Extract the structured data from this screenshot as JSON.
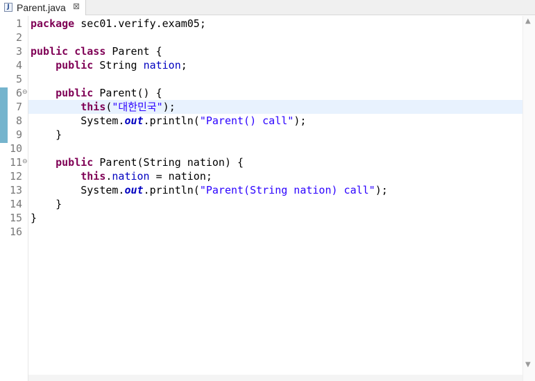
{
  "tab": {
    "title": "Parent.java",
    "icon": "java-file-icon",
    "close_glyph": "⊠"
  },
  "editor": {
    "lines": [
      {
        "n": "1",
        "tokens": [
          {
            "t": "package",
            "c": "kw"
          },
          {
            "t": " sec01.verify.exam05;",
            "c": ""
          }
        ]
      },
      {
        "n": "2",
        "tokens": []
      },
      {
        "n": "3",
        "tokens": [
          {
            "t": "public",
            "c": "kw"
          },
          {
            "t": " ",
            "c": ""
          },
          {
            "t": "class",
            "c": "kw"
          },
          {
            "t": " Parent {",
            "c": ""
          }
        ]
      },
      {
        "n": "4",
        "tokens": [
          {
            "t": "    ",
            "c": ""
          },
          {
            "t": "public",
            "c": "kw"
          },
          {
            "t": " String ",
            "c": ""
          },
          {
            "t": "nation",
            "c": "fld"
          },
          {
            "t": ";",
            "c": ""
          }
        ]
      },
      {
        "n": "5",
        "tokens": []
      },
      {
        "n": "6",
        "fold": true,
        "tokens": [
          {
            "t": "    ",
            "c": ""
          },
          {
            "t": "public",
            "c": "kw"
          },
          {
            "t": " Parent() {",
            "c": ""
          }
        ]
      },
      {
        "n": "7",
        "highlight": true,
        "tokens": [
          {
            "t": "        ",
            "c": ""
          },
          {
            "t": "this",
            "c": "kw"
          },
          {
            "t": "(",
            "c": ""
          },
          {
            "t": "\"대한민국\"",
            "c": "str"
          },
          {
            "t": ");",
            "c": ""
          }
        ]
      },
      {
        "n": "8",
        "tokens": [
          {
            "t": "        System.",
            "c": ""
          },
          {
            "t": "out",
            "c": "sfld"
          },
          {
            "t": ".println(",
            "c": ""
          },
          {
            "t": "\"Parent() call\"",
            "c": "str"
          },
          {
            "t": ");",
            "c": ""
          }
        ]
      },
      {
        "n": "9",
        "tokens": [
          {
            "t": "    }",
            "c": ""
          }
        ]
      },
      {
        "n": "10",
        "tokens": []
      },
      {
        "n": "11",
        "fold": true,
        "tokens": [
          {
            "t": "    ",
            "c": ""
          },
          {
            "t": "public",
            "c": "kw"
          },
          {
            "t": " Parent(String nation) {",
            "c": ""
          }
        ]
      },
      {
        "n": "12",
        "tokens": [
          {
            "t": "        ",
            "c": ""
          },
          {
            "t": "this",
            "c": "kw"
          },
          {
            "t": ".",
            "c": ""
          },
          {
            "t": "nation",
            "c": "fld"
          },
          {
            "t": " = nation;",
            "c": ""
          }
        ]
      },
      {
        "n": "13",
        "tokens": [
          {
            "t": "        System.",
            "c": ""
          },
          {
            "t": "out",
            "c": "sfld"
          },
          {
            "t": ".println(",
            "c": ""
          },
          {
            "t": "\"Parent(String nation) call\"",
            "c": "str"
          },
          {
            "t": ");",
            "c": ""
          }
        ]
      },
      {
        "n": "14",
        "tokens": [
          {
            "t": "    }",
            "c": ""
          }
        ]
      },
      {
        "n": "15",
        "tokens": [
          {
            "t": "}",
            "c": ""
          }
        ]
      },
      {
        "n": "16",
        "tokens": []
      }
    ]
  },
  "colors": {
    "keyword": "#7f0055",
    "field": "#0000c0",
    "string": "#2a00ff",
    "current_line": "#e8f2fe",
    "change_bar": "#5da7c4"
  }
}
